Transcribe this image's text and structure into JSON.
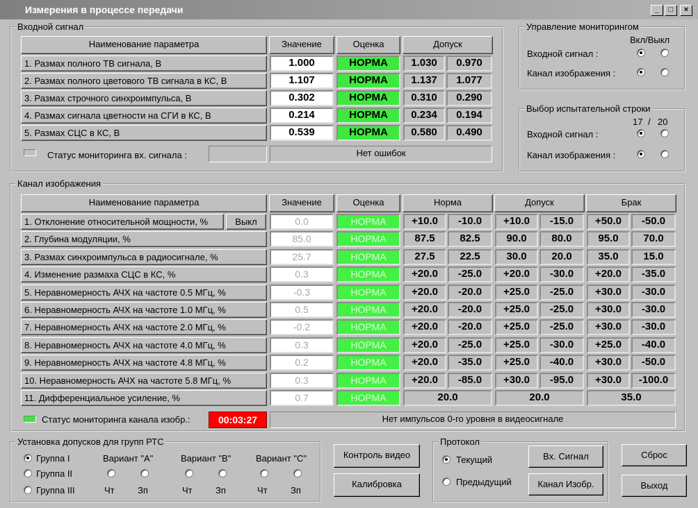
{
  "window": {
    "title": "Измерения в процессе передачи",
    "min": "_",
    "max": "□",
    "close": "×"
  },
  "input": {
    "group_label": "Входной сигнал",
    "headers": [
      "Наименование параметра",
      "Значение",
      "Оценка",
      "Допуск"
    ],
    "rows": [
      {
        "name": "1. Размах полного ТВ сигнала, В",
        "value": "1.000",
        "eval": "НОРМА",
        "t1": "1.030",
        "t2": "0.970"
      },
      {
        "name": "2. Размах полного цветового ТВ сигнала в КС, В",
        "value": "1.107",
        "eval": "НОРМА",
        "t1": "1.137",
        "t2": "1.077"
      },
      {
        "name": "3. Размах строчного синхроимпульса, В",
        "value": "0.302",
        "eval": "НОРМА",
        "t1": "0.310",
        "t2": "0.290"
      },
      {
        "name": "4. Размах сигнала цветности на СГИ в КС, В",
        "value": "0.214",
        "eval": "НОРМА",
        "t1": "0.234",
        "t2": "0.194"
      },
      {
        "name": "5. Размах СЦС в КС, В",
        "value": "0.539",
        "eval": "НОРМА",
        "t1": "0.580",
        "t2": "0.490"
      }
    ],
    "status_label": "Статус мониторинга вх. сигнала :",
    "status_text": "Нет ошибок"
  },
  "monitoring": {
    "group_label": "Управление мониторингом",
    "onoff": "Вкл/Выкл",
    "input_label": "Входной сигнал :",
    "channel_label": "Канал изображения :"
  },
  "test_line": {
    "group_label": "Выбор испытательной строки",
    "n1": "17",
    "slash": "/",
    "n2": "20",
    "input_label": "Входной сигнал :",
    "channel_label": "Канал изображения :"
  },
  "channel": {
    "group_label": "Канал изображения",
    "headers": [
      "Наименование параметра",
      "Значение",
      "Оценка",
      "Норма",
      "Допуск",
      "Брак"
    ],
    "off_button": "Выкл",
    "rows": [
      {
        "name": "1. Отклонение относительной мощности, %",
        "value": "0.0",
        "eval": "НОРМА",
        "n1": "+10.0",
        "n2": "-10.0",
        "d1": "+10.0",
        "d2": "-15.0",
        "b1": "+50.0",
        "b2": "-50.0"
      },
      {
        "name": "2. Глубина модуляции, %",
        "value": "85.0",
        "eval": "НОРМА",
        "n1": "87.5",
        "n2": "82.5",
        "d1": "90.0",
        "d2": "80.0",
        "b1": "95.0",
        "b2": "70.0"
      },
      {
        "name": "3. Размах синхроимпульса в радиосигнале, %",
        "value": "25.7",
        "eval": "НОРМА",
        "n1": "27.5",
        "n2": "22.5",
        "d1": "30.0",
        "d2": "20.0",
        "b1": "35.0",
        "b2": "15.0"
      },
      {
        "name": "4. Изменение размаха СЦС в КС, %",
        "value": "0.3",
        "eval": "НОРМА",
        "n1": "+20.0",
        "n2": "-25.0",
        "d1": "+20.0",
        "d2": "-30.0",
        "b1": "+20.0",
        "b2": "-35.0"
      },
      {
        "name": "5. Неравномерность АЧХ на частоте 0.5 МГц, %",
        "value": "-0.3",
        "eval": "НОРМА",
        "n1": "+20.0",
        "n2": "-20.0",
        "d1": "+25.0",
        "d2": "-25.0",
        "b1": "+30.0",
        "b2": "-30.0"
      },
      {
        "name": "6. Неравномерность АЧХ на частоте 1.0 МГц, %",
        "value": "0.5",
        "eval": "НОРМА",
        "n1": "+20.0",
        "n2": "-20.0",
        "d1": "+25.0",
        "d2": "-25.0",
        "b1": "+30.0",
        "b2": "-30.0"
      },
      {
        "name": "7. Неравномерность АЧХ на частоте 2.0 МГц, %",
        "value": "-0.2",
        "eval": "НОРМА",
        "n1": "+20.0",
        "n2": "-20.0",
        "d1": "+25.0",
        "d2": "-25.0",
        "b1": "+30.0",
        "b2": "-30.0"
      },
      {
        "name": "8. Неравномерность АЧХ на частоте 4.0 МГц, %",
        "value": "0.3",
        "eval": "НОРМА",
        "n1": "+20.0",
        "n2": "-25.0",
        "d1": "+25.0",
        "d2": "-30.0",
        "b1": "+25.0",
        "b2": "-40.0"
      },
      {
        "name": "9. Неравномерность АЧХ на частоте 4.8 МГц, %",
        "value": "0.2",
        "eval": "НОРМА",
        "n1": "+20.0",
        "n2": "-35.0",
        "d1": "+25.0",
        "d2": "-40.0",
        "b1": "+30.0",
        "b2": "-50.0"
      },
      {
        "name": "10. Неравномерность АЧХ на частоте 5.8 МГц, %",
        "value": "0.3",
        "eval": "НОРМА",
        "n1": "+20.0",
        "n2": "-85.0",
        "d1": "+30.0",
        "d2": "-95.0",
        "b1": "+30.0",
        "b2": "-100.0"
      }
    ],
    "row11": {
      "name": "11. Дифференциальное усиление, %",
      "value": "0.7",
      "eval": "НОРМА",
      "n": "20.0",
      "d": "20.0",
      "b": "35.0"
    },
    "status_label": "Статус мониторинга канала изобр.:",
    "timer": "00:03:27",
    "status_text": "Нет импульсов 0-го уровня в видеосигнале"
  },
  "rtc": {
    "group_label": "Установка допусков для групп РТС",
    "groups": [
      "Группа I",
      "Группа II",
      "Группа III"
    ],
    "variants": [
      "Вариант \"А\"",
      "Вариант \"В\"",
      "Вариант \"С\""
    ],
    "cht": "Чт",
    "zp": "Зп"
  },
  "buttons": {
    "video": "Контроль видео",
    "calib": "Калибровка",
    "vx": "Вх. Сигнал",
    "kanal": "Канал Изобр.",
    "reset": "Сброс",
    "exit": "Выход"
  },
  "protocol": {
    "group_label": "Протокол",
    "current": "Текущий",
    "previous": "Предыдущий"
  },
  "colors": {
    "norm_green": "#3ee83e",
    "timer_red": "#ff0000",
    "led_green": "#3ee83e"
  }
}
